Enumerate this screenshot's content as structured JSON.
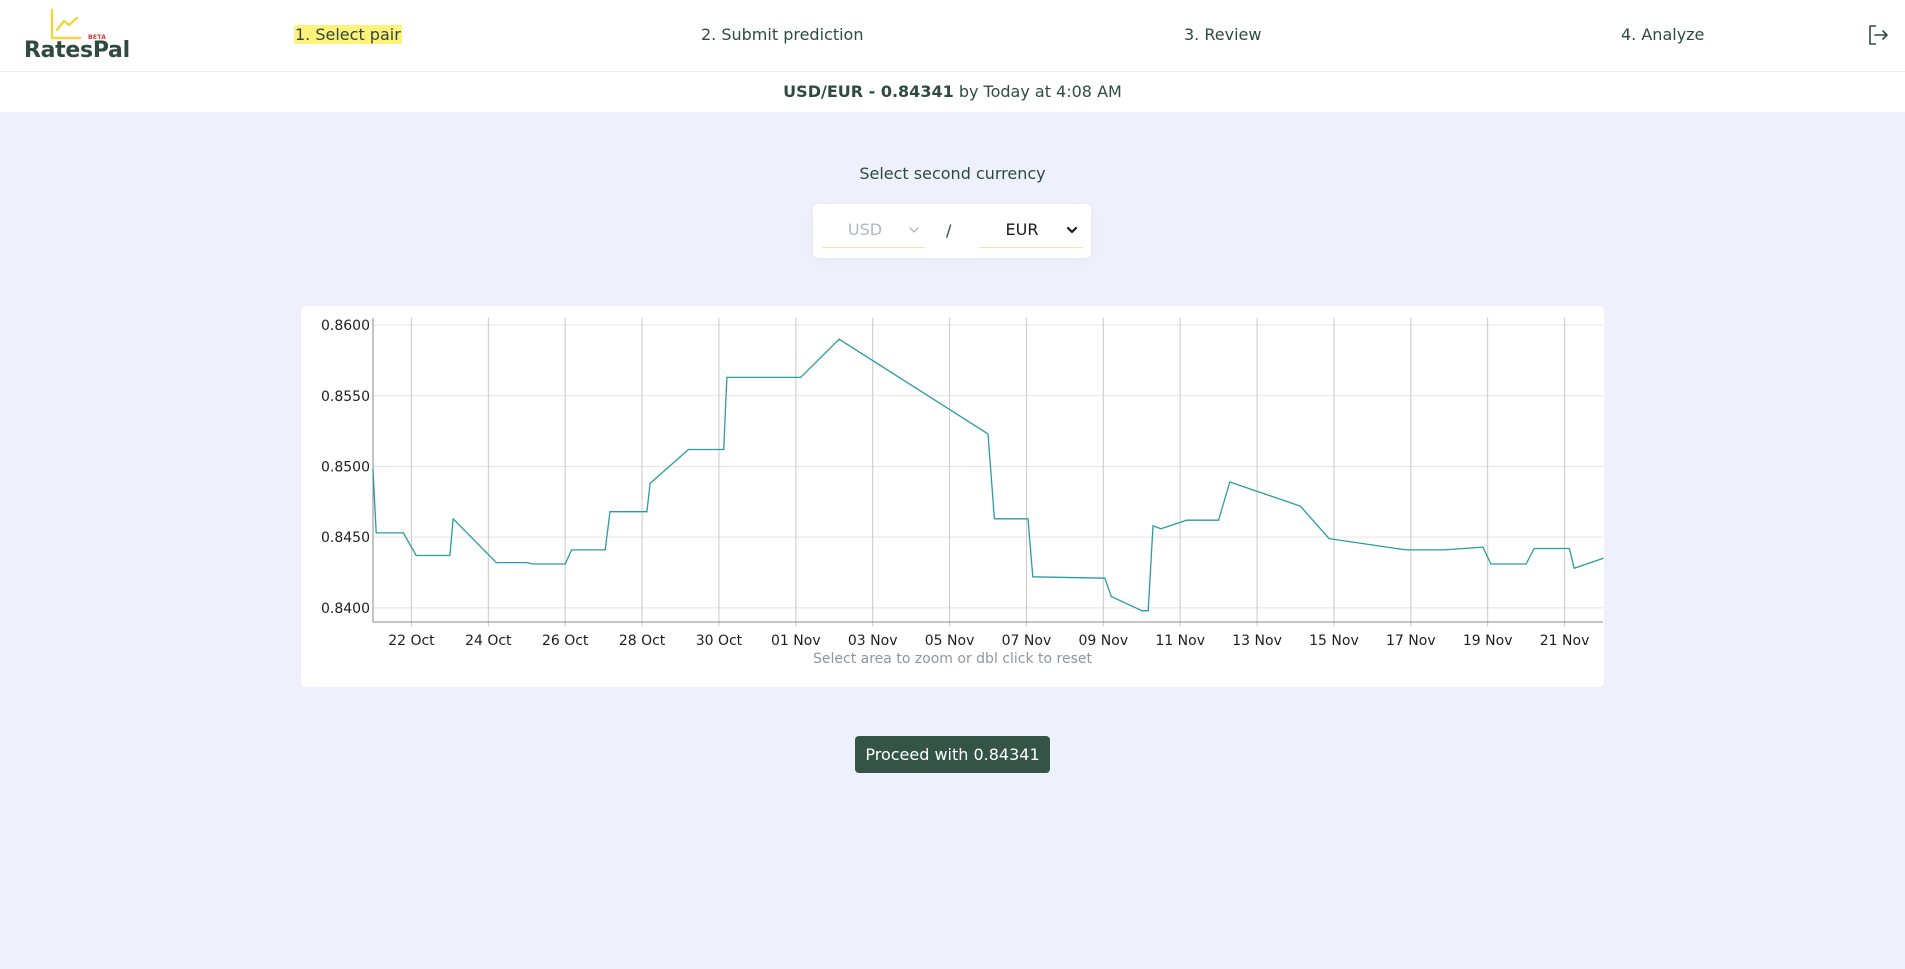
{
  "app": {
    "name": "RatesPal",
    "badge": "BETA"
  },
  "steps": [
    {
      "label": "1. Select pair",
      "active": true
    },
    {
      "label": "2. Submit prediction",
      "active": false
    },
    {
      "label": "3. Review",
      "active": false
    },
    {
      "label": "4. Analyze",
      "active": false
    }
  ],
  "icons": {
    "logo": "line-chart-icon",
    "logout": "logout-icon",
    "dropdown": "chevron-down-icon"
  },
  "ticker": {
    "pair_rate": "USD/EUR - 0.84341",
    "suffix": "by Today at 4:08 AM"
  },
  "pair_selector": {
    "title": "Select second currency",
    "base": "USD",
    "separator": "/",
    "quote": "EUR"
  },
  "chart_hint": "Select area to zoom or dbl click to reset",
  "proceed_label": "Proceed with 0.84341",
  "colors": {
    "brand_dark": "#345445",
    "text": "#2f4a40",
    "highlight": "#fff27a",
    "line": "#2a9ba3",
    "background": "#eef1fb",
    "badge": "#e0332b"
  },
  "chart_data": {
    "type": "line",
    "title": "",
    "xlabel": "",
    "ylabel": "",
    "ylim": [
      0.839,
      0.8605
    ],
    "xlim": [
      "2025-10-21",
      "2025-11-22"
    ],
    "grid": true,
    "legend": "none",
    "y_ticks": [
      "0.8400",
      "0.8450",
      "0.8500",
      "0.8550",
      "0.8600"
    ],
    "x_ticks": [
      "22 Oct",
      "24 Oct",
      "26 Oct",
      "28 Oct",
      "30 Oct",
      "01 Nov",
      "03 Nov",
      "05 Nov",
      "07 Nov",
      "09 Nov",
      "11 Nov",
      "13 Nov",
      "15 Nov",
      "17 Nov",
      "19 Nov",
      "21 Nov"
    ],
    "x_tick_dates": [
      "2025-10-22",
      "2025-10-24",
      "2025-10-26",
      "2025-10-28",
      "2025-10-30",
      "2025-11-01",
      "2025-11-03",
      "2025-11-05",
      "2025-11-07",
      "2025-11-09",
      "2025-11-11",
      "2025-11-13",
      "2025-11-15",
      "2025-11-17",
      "2025-11-19",
      "2025-11-21"
    ],
    "series": [
      {
        "points": [
          [
            "2025-10-21 00:00",
            0.8498
          ],
          [
            "2025-10-21 02:00",
            0.8453
          ],
          [
            "2025-10-21 19:00",
            0.8453
          ],
          [
            "2025-10-22 03:00",
            0.8437
          ],
          [
            "2025-10-23 00:00",
            0.8437
          ],
          [
            "2025-10-23 02:00",
            0.8463
          ],
          [
            "2025-10-24 05:00",
            0.8432
          ],
          [
            "2025-10-25 00:00",
            0.8432
          ],
          [
            "2025-10-25 04:00",
            0.8431
          ],
          [
            "2025-10-26 00:00",
            0.8431
          ],
          [
            "2025-10-26 04:00",
            0.8441
          ],
          [
            "2025-10-27 01:00",
            0.8441
          ],
          [
            "2025-10-27 04:00",
            0.8468
          ],
          [
            "2025-10-28 03:00",
            0.8468
          ],
          [
            "2025-10-28 05:00",
            0.8488
          ],
          [
            "2025-10-29 05:00",
            0.8512
          ],
          [
            "2025-10-30 03:00",
            0.8512
          ],
          [
            "2025-10-30 05:00",
            0.8563
          ],
          [
            "2025-11-01 03:00",
            0.8563
          ],
          [
            "2025-11-02 03:00",
            0.859
          ],
          [
            "2025-11-06 00:00",
            0.8523
          ],
          [
            "2025-11-06 04:00",
            0.8463
          ],
          [
            "2025-11-07 01:00",
            0.8463
          ],
          [
            "2025-11-07 04:00",
            0.8422
          ],
          [
            "2025-11-09 01:00",
            0.8421
          ],
          [
            "2025-11-09 05:00",
            0.8408
          ],
          [
            "2025-11-10 00:00",
            0.8398
          ],
          [
            "2025-11-10 04:00",
            0.8398
          ],
          [
            "2025-11-10 07:00",
            0.8458
          ],
          [
            "2025-11-10 12:00",
            0.8456
          ],
          [
            "2025-11-11 04:00",
            0.8462
          ],
          [
            "2025-11-12 00:00",
            0.8462
          ],
          [
            "2025-11-12 07:00",
            0.8489
          ],
          [
            "2025-11-14 03:00",
            0.8472
          ],
          [
            "2025-11-14 21:00",
            0.8449
          ],
          [
            "2025-11-16 21:00",
            0.8441
          ],
          [
            "2025-11-17 21:00",
            0.8441
          ],
          [
            "2025-11-18 21:00",
            0.8443
          ],
          [
            "2025-11-19 02:00",
            0.8431
          ],
          [
            "2025-11-20 00:00",
            0.8431
          ],
          [
            "2025-11-20 05:00",
            0.8442
          ],
          [
            "2025-11-21 03:00",
            0.8442
          ],
          [
            "2025-11-21 06:00",
            0.8428
          ],
          [
            "2025-11-22 03:00",
            0.8435
          ],
          [
            "2025-11-23 04:00",
            0.8435
          ]
        ]
      }
    ]
  }
}
